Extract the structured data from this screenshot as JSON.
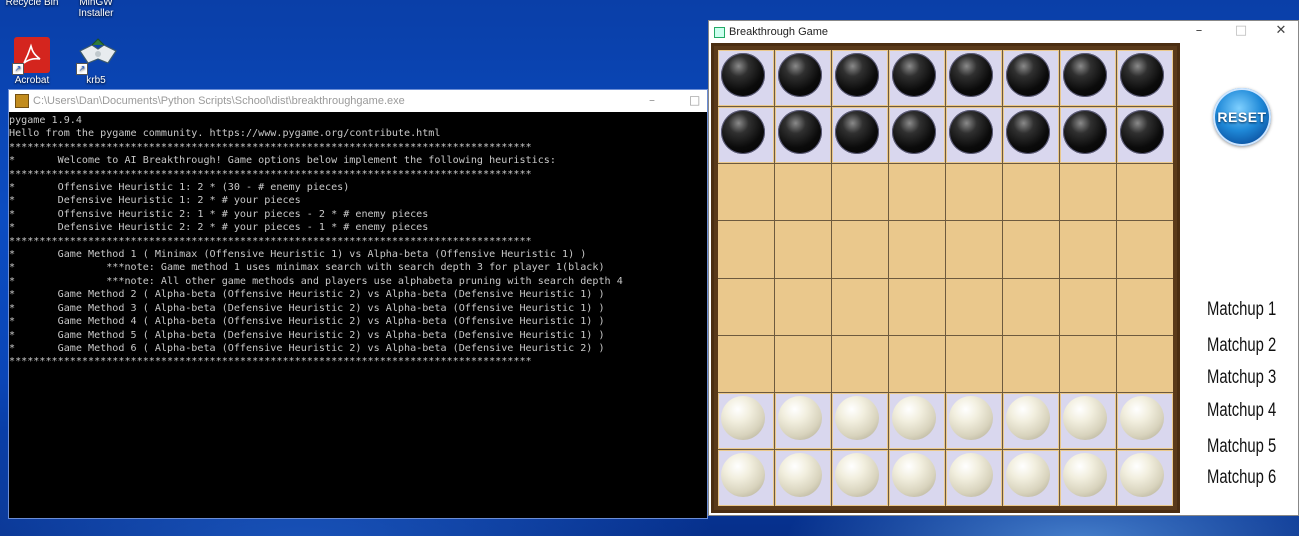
{
  "desktop": {
    "icons": [
      {
        "label": "Recycle Bin"
      },
      {
        "label": "MinGW Installer"
      },
      {
        "label": "Acrobat"
      },
      {
        "label": "krb5"
      }
    ]
  },
  "console": {
    "title": "C:\\Users\\Dan\\Documents\\Python Scripts\\School\\dist\\breakthroughgame.exe",
    "output": "pygame 1.9.4\nHello from the pygame community. https://www.pygame.org/contribute.html\n**************************************************************************************\n*       Welcome to AI Breakthrough! Game options below implement the following heuristics:\n**************************************************************************************\n*       Offensive Heuristic 1: 2 * (30 - # enemy pieces)\n*       Defensive Heuristic 1: 2 * # your pieces\n*       Offensive Heuristic 2: 1 * # your pieces - 2 * # enemy pieces\n*       Defensive Heuristic 2: 2 * # your pieces - 1 * # enemy pieces\n**************************************************************************************\n*       Game Method 1 ( Minimax (Offensive Heuristic 1) vs Alpha-beta (Offensive Heuristic 1) )\n*               ***note: Game method 1 uses minimax search with search depth 3 for player 1(black)\n*               ***note: All other game methods and players use alphabeta pruning with search depth 4\n*       Game Method 2 ( Alpha-beta (Offensive Heuristic 2) vs Alpha-beta (Defensive Heuristic 1) )\n*       Game Method 3 ( Alpha-beta (Defensive Heuristic 2) vs Alpha-beta (Offensive Heuristic 1) )\n*       Game Method 4 ( Alpha-beta (Offensive Heuristic 2) vs Alpha-beta (Offensive Heuristic 1) )\n*       Game Method 5 ( Alpha-beta (Defensive Heuristic 2) vs Alpha-beta (Defensive Heuristic 1) )\n*       Game Method 6 ( Alpha-beta (Offensive Heuristic 2) vs Alpha-beta (Defensive Heuristic 2) )\n**************************************************************************************"
  },
  "game": {
    "title": "Breakthrough Game",
    "window_buttons": {
      "minimize": "–",
      "maximize": "□",
      "close": "✕"
    },
    "board": {
      "rows": 8,
      "cols": 8,
      "layout": [
        "BBBBBBBB",
        "BBBBBBBB",
        "........",
        "........",
        "........",
        "........",
        "WWWWWWWW",
        "WWWWWWWW"
      ]
    },
    "reset_label": "RESET",
    "matchups": [
      "Matchup 1",
      "Matchup 2",
      "Matchup 3",
      "Matchup 4",
      "Matchup 5",
      "Matchup 6"
    ]
  },
  "colors": {
    "board_light": "#eac88c",
    "board_frame": "#5a3a1a",
    "reset_blue": "#1f89d8"
  }
}
